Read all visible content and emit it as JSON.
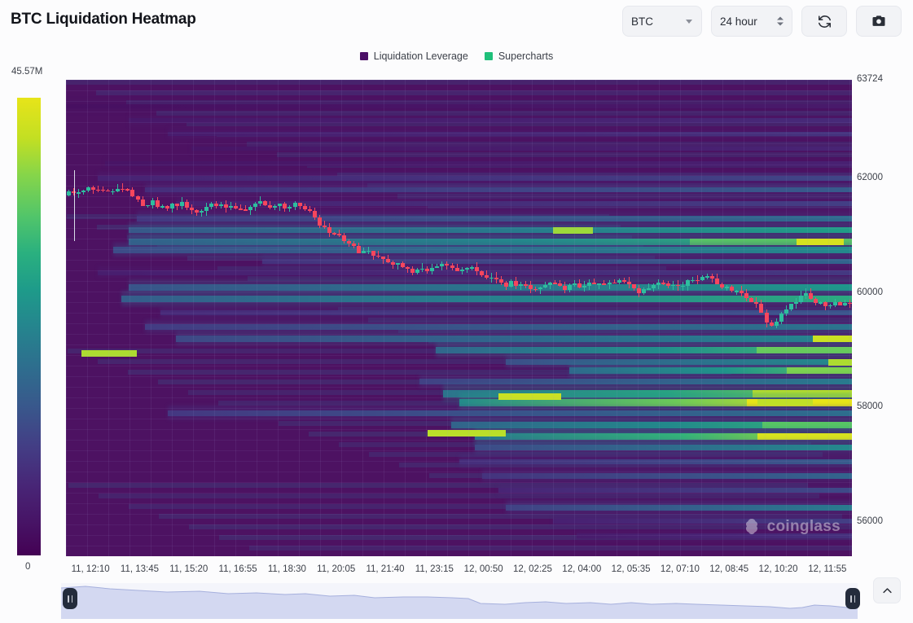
{
  "header": {
    "title": "BTC Liquidation Heatmap",
    "symbol_select": {
      "value": "BTC",
      "icon": "chevron-down-icon"
    },
    "timeframe_select": {
      "value": "24 hour",
      "icon": "stepper-icon"
    },
    "refresh_button": {
      "icon": "refresh-icon",
      "label": ""
    },
    "camera_button": {
      "icon": "camera-icon",
      "label": ""
    }
  },
  "legend": {
    "items": [
      {
        "label": "Liquidation Leverage",
        "color": "#4b0f66"
      },
      {
        "label": "Supercharts",
        "color": "#1fc07a"
      }
    ]
  },
  "colorbar": {
    "max_label": "45.57M",
    "min_label": "0"
  },
  "watermark": {
    "text": "coinglass"
  },
  "chart_data": {
    "type": "heatmap",
    "title": "BTC Liquidation Heatmap",
    "xlabel": "",
    "ylabel": "",
    "grid": true,
    "legend_position": "top-center",
    "colorbar": {
      "min": 0,
      "max": 45570000,
      "max_label": "45.57M",
      "min_label": "0",
      "scale": "viridis"
    },
    "ylim": [
      55400,
      63724
    ],
    "y_ticks": [
      "63724",
      "62000",
      "60000",
      "58000",
      "56000"
    ],
    "y_tick_values": [
      63724,
      62000,
      60000,
      58000,
      56000
    ],
    "x_ticks": [
      "11, 12:10",
      "11, 13:45",
      "11, 15:20",
      "11, 16:55",
      "11, 18:30",
      "11, 20:05",
      "11, 21:40",
      "11, 23:15",
      "12, 00:50",
      "12, 02:25",
      "12, 04:00",
      "12, 05:35",
      "12, 07:10",
      "12, 08:45",
      "12, 10:20",
      "12, 11:55"
    ],
    "series": [
      {
        "name": "Liquidation Leverage",
        "type": "heatmap",
        "note": "horizontal liquidation-level bands; intensity encoded 0 to 45.57M on viridis colorbar",
        "bands": [
          {
            "price": 63300,
            "x_start": 0.0,
            "x_end": 1.0,
            "intensity": 0.1
          },
          {
            "price": 63050,
            "x_start": 0.08,
            "x_end": 1.0,
            "intensity": 0.16
          },
          {
            "price": 62820,
            "x_start": 0.13,
            "x_end": 1.0,
            "intensity": 0.19
          },
          {
            "price": 62560,
            "x_start": 0.16,
            "x_end": 1.0,
            "intensity": 0.14
          },
          {
            "price": 62300,
            "x_start": 0.05,
            "x_end": 1.0,
            "intensity": 0.13
          },
          {
            "price": 62050,
            "x_start": 0.04,
            "x_end": 1.0,
            "intensity": 0.24
          },
          {
            "price": 61850,
            "x_start": 0.1,
            "x_end": 1.0,
            "intensity": 0.3
          },
          {
            "price": 61600,
            "x_start": 0.14,
            "x_end": 1.0,
            "intensity": 0.22
          },
          {
            "price": 61350,
            "x_start": 0.09,
            "x_end": 1.0,
            "intensity": 0.35
          },
          {
            "price": 61150,
            "x_start": 0.08,
            "x_end": 1.0,
            "intensity": 0.52
          },
          {
            "price": 60950,
            "x_start": 0.08,
            "x_end": 1.0,
            "intensity": 0.58
          },
          {
            "price": 60800,
            "x_start": 0.06,
            "x_end": 1.0,
            "intensity": 0.46
          },
          {
            "price": 60600,
            "x_start": 0.25,
            "x_end": 1.0,
            "intensity": 0.33
          },
          {
            "price": 60400,
            "x_start": 0.04,
            "x_end": 1.0,
            "intensity": 0.2
          },
          {
            "price": 60150,
            "x_start": 0.08,
            "x_end": 1.0,
            "intensity": 0.5
          },
          {
            "price": 59950,
            "x_start": 0.07,
            "x_end": 1.0,
            "intensity": 0.55
          },
          {
            "price": 59700,
            "x_start": 0.12,
            "x_end": 1.0,
            "intensity": 0.28
          },
          {
            "price": 59450,
            "x_start": 0.1,
            "x_end": 1.0,
            "intensity": 0.38
          },
          {
            "price": 59250,
            "x_start": 0.14,
            "x_end": 1.0,
            "intensity": 0.44
          },
          {
            "price": 59050,
            "x_start": 0.47,
            "x_end": 1.0,
            "intensity": 0.6
          },
          {
            "price": 58850,
            "x_start": 0.56,
            "x_end": 1.0,
            "intensity": 0.47
          },
          {
            "price": 58700,
            "x_start": 0.64,
            "x_end": 1.0,
            "intensity": 0.62
          },
          {
            "price": 58500,
            "x_start": 0.45,
            "x_end": 1.0,
            "intensity": 0.4
          },
          {
            "price": 58300,
            "x_start": 0.48,
            "x_end": 1.0,
            "intensity": 0.68
          },
          {
            "price": 58150,
            "x_start": 0.5,
            "x_end": 1.0,
            "intensity": 0.82
          },
          {
            "price": 57950,
            "x_start": 0.13,
            "x_end": 1.0,
            "intensity": 0.36
          },
          {
            "price": 57750,
            "x_start": 0.49,
            "x_end": 1.0,
            "intensity": 0.58
          },
          {
            "price": 57550,
            "x_start": 0.52,
            "x_end": 1.0,
            "intensity": 0.72
          },
          {
            "price": 57350,
            "x_start": 0.52,
            "x_end": 1.0,
            "intensity": 0.45
          },
          {
            "price": 57100,
            "x_start": 0.5,
            "x_end": 1.0,
            "intensity": 0.3
          },
          {
            "price": 56850,
            "x_start": 0.53,
            "x_end": 1.0,
            "intensity": 0.33
          },
          {
            "price": 56600,
            "x_start": 0.55,
            "x_end": 1.0,
            "intensity": 0.25
          },
          {
            "price": 56300,
            "x_start": 0.56,
            "x_end": 1.0,
            "intensity": 0.4
          },
          {
            "price": 56050,
            "x_start": 0.62,
            "x_end": 1.0,
            "intensity": 0.22
          },
          {
            "price": 55800,
            "x_start": 0.65,
            "x_end": 1.0,
            "intensity": 0.18
          }
        ]
      },
      {
        "name": "Supercharts",
        "type": "candlestick",
        "color_up": "#2ebd9e",
        "color_down": "#f6465d",
        "open_high_low_close_note": "BTC price declines from ~62000 to ~58500 over 24 hours"
      }
    ]
  },
  "brush": {
    "left_handle": "range-handle-left",
    "right_handle": "range-handle-right"
  },
  "scroll_top": {
    "icon": "chevron-up-icon"
  }
}
